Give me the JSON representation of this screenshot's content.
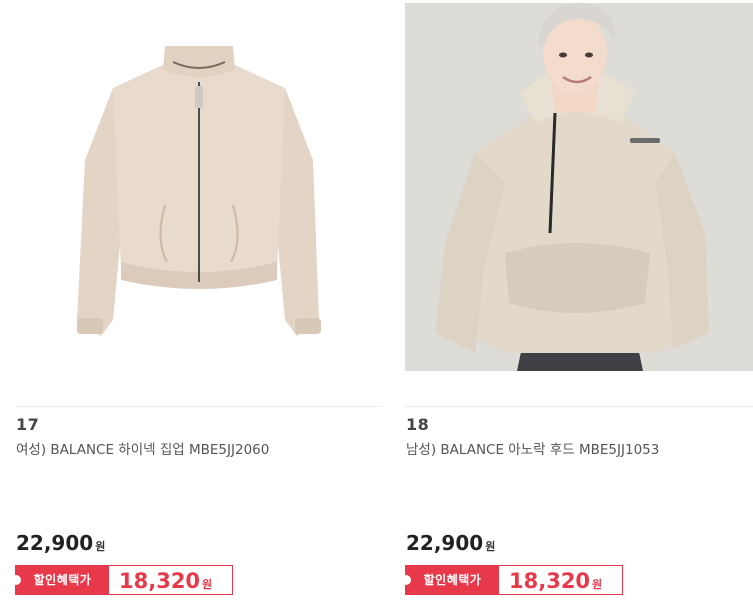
{
  "products": [
    {
      "rank": "17",
      "name": "여성) BALANCE 하이넥 집업 MBE5JJ2060",
      "price": "22,900",
      "price_unit": "원",
      "discount_label": "할인혜택가",
      "sale_price": "18,320",
      "sale_unit": "원",
      "image": "beige-high-neck-zip-jacket-photo"
    },
    {
      "rank": "18",
      "name": "남성) BALANCE 아노락 후드 MBE5JJ1053",
      "price": "22,900",
      "price_unit": "원",
      "discount_label": "할인혜택가",
      "sale_price": "18,320",
      "sale_unit": "원",
      "image": "model-in-anorak-hood-photo"
    }
  ],
  "colors": {
    "accent": "#e8394a",
    "jacket": "#e6d8ca",
    "photo_bg": "#dcdbd5"
  }
}
